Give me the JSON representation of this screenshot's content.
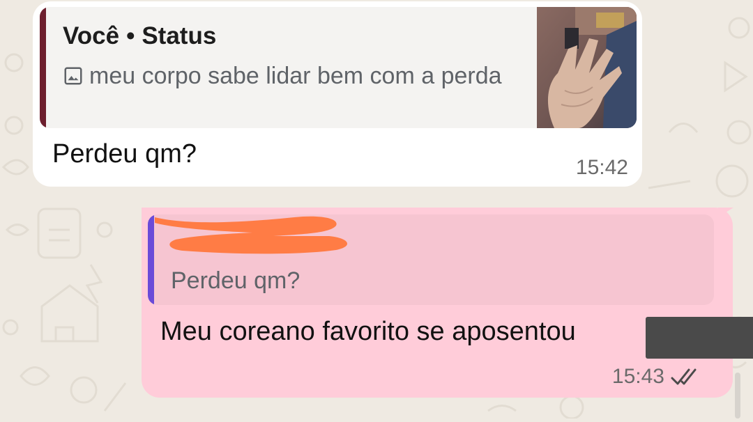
{
  "wallpaper": {
    "color": "#efeae2",
    "doodle_color": "#e2dcd2"
  },
  "incoming": {
    "quote": {
      "author": "Você",
      "separator": "•",
      "source": "Status",
      "icon": "image-icon",
      "text": "meu corpo sabe lidar bem com a perda",
      "bar_color": "#6d1f2e"
    },
    "message": "Perdeu qm?",
    "time": "15:42"
  },
  "outgoing": {
    "quote": {
      "author_redacted": true,
      "text": "Perdeu qm?",
      "bar_color": "#6a4bd8"
    },
    "message": "Meu coreano favorito se aposentou",
    "time": "15:43",
    "status_icon": "double-check-icon",
    "bubble_color": "#ffccd9"
  }
}
